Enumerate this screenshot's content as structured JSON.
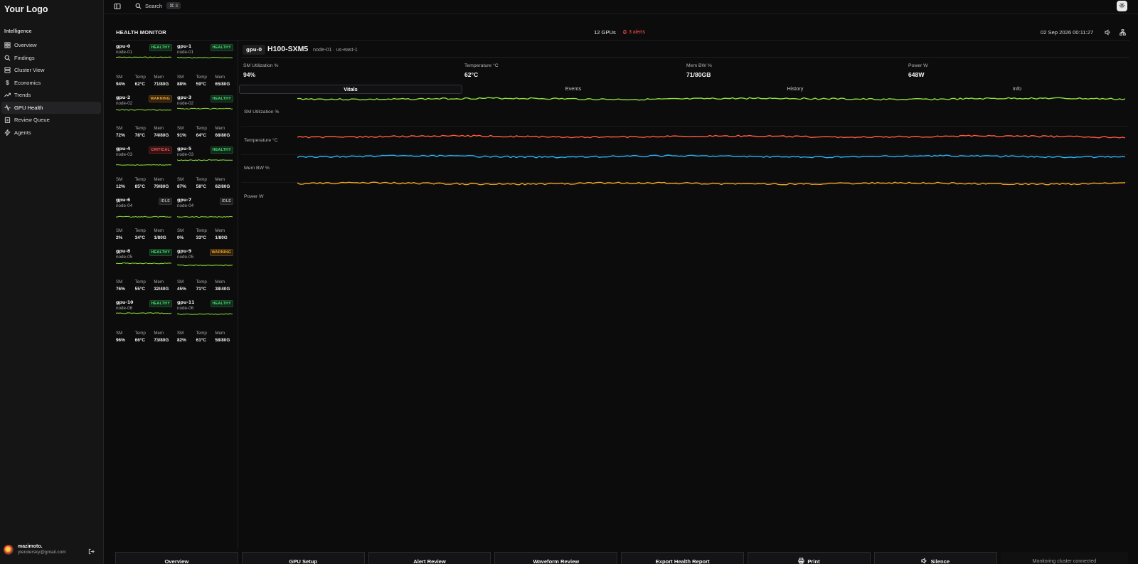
{
  "sidebar": {
    "logo": "Your Logo",
    "section": "Intelligence",
    "items": [
      {
        "label": "Overview",
        "icon": "grid-icon"
      },
      {
        "label": "Findings",
        "icon": "search-icon"
      },
      {
        "label": "Cluster View",
        "icon": "server-icon"
      },
      {
        "label": "Economics",
        "icon": "dollar-icon"
      },
      {
        "label": "Trends",
        "icon": "trend-icon"
      },
      {
        "label": "GPU Health",
        "icon": "pulse-icon",
        "active": true
      },
      {
        "label": "Review Queue",
        "icon": "clipboard-icon"
      },
      {
        "label": "Agents",
        "icon": "bolt-icon"
      }
    ],
    "user": {
      "name": "mazimoto.",
      "email": "ytendersky@gmail.com"
    }
  },
  "topbar": {
    "search_label": "Search",
    "search_shortcut": "⌘ 3"
  },
  "monitor": {
    "title": "HEALTH MONITOR",
    "gpu_count": "12 GPUs",
    "alerts": "3 alerts",
    "datetime": "02 Sep 2026  00:11:27"
  },
  "stat_labels": {
    "sm": "SM",
    "temp": "Temp",
    "mem": "Mem"
  },
  "gpus": [
    {
      "id": "gpu-0",
      "node": "node-01",
      "status": "HEALTHY",
      "sm": "94%",
      "temp": "62°C",
      "mem": "71/80G"
    },
    {
      "id": "gpu-1",
      "node": "node-01",
      "status": "HEALTHY",
      "sm": "88%",
      "temp": "59°C",
      "mem": "65/80G"
    },
    {
      "id": "gpu-2",
      "node": "node-02",
      "status": "WARNING",
      "sm": "72%",
      "temp": "78°C",
      "mem": "74/80G"
    },
    {
      "id": "gpu-3",
      "node": "node-02",
      "status": "HEALTHY",
      "sm": "91%",
      "temp": "64°C",
      "mem": "68/80G"
    },
    {
      "id": "gpu-4",
      "node": "node-03",
      "status": "CRITICAL",
      "sm": "12%",
      "temp": "85°C",
      "mem": "79/80G"
    },
    {
      "id": "gpu-5",
      "node": "node-03",
      "status": "HEALTHY",
      "sm": "87%",
      "temp": "58°C",
      "mem": "62/80G"
    },
    {
      "id": "gpu-6",
      "node": "node-04",
      "status": "IDLE",
      "sm": "2%",
      "temp": "34°C",
      "mem": "1/80G"
    },
    {
      "id": "gpu-7",
      "node": "node-04",
      "status": "IDLE",
      "sm": "0%",
      "temp": "33°C",
      "mem": "1/80G"
    },
    {
      "id": "gpu-8",
      "node": "node-05",
      "status": "HEALTHY",
      "sm": "76%",
      "temp": "55°C",
      "mem": "32/40G"
    },
    {
      "id": "gpu-9",
      "node": "node-05",
      "status": "WARNING",
      "sm": "45%",
      "temp": "71°C",
      "mem": "38/40G"
    },
    {
      "id": "gpu-10",
      "node": "node-06",
      "status": "HEALTHY",
      "sm": "96%",
      "temp": "66°C",
      "mem": "73/80G"
    },
    {
      "id": "gpu-11",
      "node": "node-06",
      "status": "HEALTHY",
      "sm": "82%",
      "temp": "61°C",
      "mem": "58/80G"
    }
  ],
  "detail": {
    "gpu_id": "gpu-0",
    "model": "H100-SXM5",
    "location": "node-01 · us-east-1",
    "metrics": [
      {
        "label": "SM Utilization %",
        "value": "94%"
      },
      {
        "label": "Temperature °C",
        "value": "62°C"
      },
      {
        "label": "Mem BW %",
        "value": "71/80GB"
      },
      {
        "label": "Power W",
        "value": "648W"
      }
    ],
    "tabs": [
      "Vitals",
      "Events",
      "History",
      "Info"
    ],
    "traces": [
      {
        "label": "SM Utilization %",
        "color": "#8ee03a"
      },
      {
        "label": "Temperature °C",
        "color": "#ff5a3c"
      },
      {
        "label": "Mem BW %",
        "color": "#29b6f6"
      },
      {
        "label": "Power W",
        "color": "#f5a623"
      }
    ]
  },
  "colors": {
    "healthy": "#4fe07a",
    "warning": "#f5a623",
    "critical": "#ff5a5a",
    "idle": "#a9a9a9",
    "spark": "#8ee03a"
  },
  "bottom": {
    "buttons": [
      "Overview",
      "GPU Setup",
      "Alert Review",
      "Waveform Review",
      "Export Health Report",
      "Print",
      "Silence"
    ],
    "status": "Monitoring cluster connected"
  }
}
